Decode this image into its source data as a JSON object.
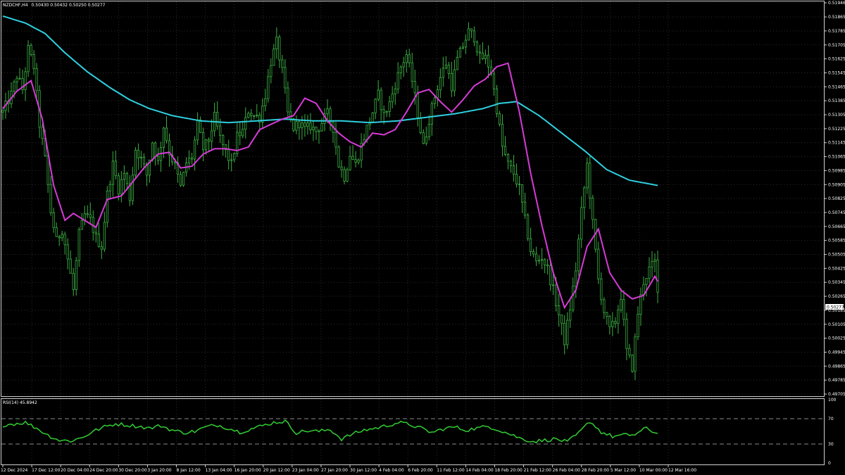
{
  "header": {
    "symbol": "NZDCHF,H4",
    "ohlc": "0.50430 0.50432 0.50250 0.50277"
  },
  "colors": {
    "background": "#000000",
    "grid": "#2a2a2a",
    "candle": "#3cb043",
    "ma_fast": "#d63bd6",
    "ma_slow": "#2fd0e0",
    "rsi_line": "#32cd32",
    "rsi_level": "#8a8a8a",
    "axis_text": "#ffffff",
    "frame": "#d0d0d0"
  },
  "chart_data": [
    {
      "type": "candlestick",
      "title": "NZDCHF,H4",
      "ohlc_label": "0.50430 0.50432 0.50250 0.50277",
      "ylim": [
        0.49705,
        0.51946
      ],
      "yticks": [
        "0.51946",
        "0.51865",
        "0.51785",
        "0.51705",
        "0.51625",
        "0.51545",
        "0.51465",
        "0.51385",
        "0.51305",
        "0.51225",
        "0.51145",
        "0.51065",
        "0.50985",
        "0.50905",
        "0.50825",
        "0.50745",
        "0.50665",
        "0.50585",
        "0.50505",
        "0.50425",
        "0.50345",
        "0.50265",
        "0.50185",
        "0.50105",
        "0.50025",
        "0.49945",
        "0.49865",
        "0.49785",
        "0.49705"
      ],
      "current_price": "0.50277",
      "close_anchors": [
        [
          0,
          0.5132
        ],
        [
          3,
          0.5142
        ],
        [
          5,
          0.5153
        ],
        [
          7,
          0.5145
        ],
        [
          9,
          0.5168
        ],
        [
          11,
          0.5158
        ],
        [
          13,
          0.5125
        ],
        [
          15,
          0.5105
        ],
        [
          17,
          0.5075
        ],
        [
          19,
          0.5058
        ],
        [
          21,
          0.5065
        ],
        [
          23,
          0.5048
        ],
        [
          25,
          0.503
        ],
        [
          27,
          0.5062
        ],
        [
          29,
          0.5073
        ],
        [
          31,
          0.507
        ],
        [
          33,
          0.506
        ],
        [
          35,
          0.5055
        ],
        [
          37,
          0.5085
        ],
        [
          39,
          0.5102
        ],
        [
          41,
          0.5088
        ],
        [
          43,
          0.5097
        ],
        [
          45,
          0.5083
        ],
        [
          47,
          0.5111
        ],
        [
          49,
          0.5105
        ],
        [
          51,
          0.5096
        ],
        [
          53,
          0.5115
        ],
        [
          55,
          0.5103
        ],
        [
          57,
          0.5124
        ],
        [
          59,
          0.5109
        ],
        [
          61,
          0.5101
        ],
        [
          63,
          0.5089
        ],
        [
          65,
          0.5103
        ],
        [
          67,
          0.5106
        ],
        [
          69,
          0.5125
        ],
        [
          71,
          0.5111
        ],
        [
          73,
          0.5116
        ],
        [
          75,
          0.5129
        ],
        [
          77,
          0.5117
        ],
        [
          79,
          0.5109
        ],
        [
          81,
          0.5102
        ],
        [
          83,
          0.5118
        ],
        [
          85,
          0.5121
        ],
        [
          87,
          0.5133
        ],
        [
          89,
          0.513
        ],
        [
          91,
          0.5129
        ],
        [
          93,
          0.5142
        ],
        [
          95,
          0.5161
        ],
        [
          97,
          0.5172
        ],
        [
          99,
          0.5155
        ],
        [
          101,
          0.5131
        ],
        [
          103,
          0.5123
        ],
        [
          105,
          0.5126
        ],
        [
          107,
          0.5122
        ],
        [
          109,
          0.5124
        ],
        [
          111,
          0.5121
        ],
        [
          113,
          0.5126
        ],
        [
          115,
          0.5131
        ],
        [
          117,
          0.5123
        ],
        [
          119,
          0.5102
        ],
        [
          121,
          0.5095
        ],
        [
          123,
          0.5108
        ],
        [
          125,
          0.5102
        ],
        [
          127,
          0.5113
        ],
        [
          129,
          0.5123
        ],
        [
          131,
          0.5132
        ],
        [
          133,
          0.5142
        ],
        [
          135,
          0.513
        ],
        [
          137,
          0.5137
        ],
        [
          139,
          0.5148
        ],
        [
          141,
          0.5158
        ],
        [
          143,
          0.5165
        ],
        [
          145,
          0.515
        ],
        [
          147,
          0.5131
        ],
        [
          149,
          0.5112
        ],
        [
          151,
          0.5128
        ],
        [
          153,
          0.5141
        ],
        [
          155,
          0.5152
        ],
        [
          157,
          0.516
        ],
        [
          159,
          0.5147
        ],
        [
          161,
          0.5162
        ],
        [
          163,
          0.517
        ],
        [
          165,
          0.5178
        ],
        [
          167,
          0.5175
        ],
        [
          169,
          0.5163
        ],
        [
          171,
          0.5163
        ],
        [
          173,
          0.5155
        ],
        [
          175,
          0.5134
        ],
        [
          177,
          0.5112
        ],
        [
          179,
          0.5102
        ],
        [
          181,
          0.5097
        ],
        [
          183,
          0.5088
        ],
        [
          185,
          0.507
        ],
        [
          187,
          0.5053
        ],
        [
          189,
          0.5046
        ],
        [
          191,
          0.5049
        ],
        [
          193,
          0.5042
        ],
        [
          195,
          0.503
        ],
        [
          197,
          0.5016
        ],
        [
          199,
          0.5001
        ],
        [
          201,
          0.502
        ],
        [
          203,
          0.5042
        ],
        [
          205,
          0.5075
        ],
        [
          207,
          0.5102
        ],
        [
          209,
          0.5068
        ],
        [
          211,
          0.5036
        ],
        [
          213,
          0.5018
        ],
        [
          215,
          0.5007
        ],
        [
          217,
          0.5012
        ],
        [
          219,
          0.5027
        ],
        [
          221,
          0.4995
        ],
        [
          223,
          0.4986
        ],
        [
          225,
          0.5017
        ],
        [
          227,
          0.5035
        ],
        [
          229,
          0.5042
        ],
        [
          231,
          0.5046
        ],
        [
          232,
          0.50277
        ]
      ],
      "ma_fast_anchors": [
        [
          0,
          0.5134
        ],
        [
          5,
          0.5144
        ],
        [
          10,
          0.515
        ],
        [
          14,
          0.5128
        ],
        [
          18,
          0.509
        ],
        [
          22,
          0.507
        ],
        [
          25,
          0.5074
        ],
        [
          29,
          0.507
        ],
        [
          33,
          0.5066
        ],
        [
          37,
          0.5082
        ],
        [
          42,
          0.5084
        ],
        [
          46,
          0.5092
        ],
        [
          50,
          0.51
        ],
        [
          55,
          0.5108
        ],
        [
          59,
          0.5109
        ],
        [
          63,
          0.51
        ],
        [
          67,
          0.5101
        ],
        [
          71,
          0.5108
        ],
        [
          75,
          0.5111
        ],
        [
          79,
          0.5111
        ],
        [
          83,
          0.511
        ],
        [
          87,
          0.5112
        ],
        [
          91,
          0.5122
        ],
        [
          95,
          0.5125
        ],
        [
          99,
          0.5128
        ],
        [
          103,
          0.513
        ],
        [
          107,
          0.514
        ],
        [
          111,
          0.5137
        ],
        [
          115,
          0.5127
        ],
        [
          119,
          0.512
        ],
        [
          123,
          0.5115
        ],
        [
          127,
          0.5112
        ],
        [
          131,
          0.512
        ],
        [
          135,
          0.5119
        ],
        [
          139,
          0.5122
        ],
        [
          143,
          0.5132
        ],
        [
          147,
          0.5143
        ],
        [
          151,
          0.5145
        ],
        [
          155,
          0.5138
        ],
        [
          159,
          0.5132
        ],
        [
          163,
          0.5139
        ],
        [
          167,
          0.5147
        ],
        [
          171,
          0.5151
        ],
        [
          175,
          0.5158
        ],
        [
          179,
          0.516
        ],
        [
          183,
          0.5132
        ],
        [
          187,
          0.5097
        ],
        [
          191,
          0.5067
        ],
        [
          195,
          0.504
        ],
        [
          199,
          0.502
        ],
        [
          203,
          0.503
        ],
        [
          207,
          0.5055
        ],
        [
          211,
          0.5065
        ],
        [
          215,
          0.504
        ],
        [
          219,
          0.503
        ],
        [
          223,
          0.5025
        ],
        [
          227,
          0.5027
        ],
        [
          231,
          0.5038
        ],
        [
          232,
          0.5035
        ]
      ],
      "ma_slow_anchors": [
        [
          0,
          0.5187
        ],
        [
          8,
          0.5183
        ],
        [
          15,
          0.5177
        ],
        [
          22,
          0.5166
        ],
        [
          30,
          0.5155
        ],
        [
          38,
          0.5146
        ],
        [
          45,
          0.5139
        ],
        [
          52,
          0.5134
        ],
        [
          60,
          0.513
        ],
        [
          70,
          0.5127
        ],
        [
          80,
          0.5126
        ],
        [
          90,
          0.5127
        ],
        [
          100,
          0.5128
        ],
        [
          110,
          0.5127
        ],
        [
          120,
          0.5127
        ],
        [
          130,
          0.5126
        ],
        [
          140,
          0.5127
        ],
        [
          150,
          0.5129
        ],
        [
          160,
          0.5131
        ],
        [
          170,
          0.5134
        ],
        [
          176,
          0.5137
        ],
        [
          182,
          0.5138
        ],
        [
          190,
          0.513
        ],
        [
          198,
          0.512
        ],
        [
          206,
          0.511
        ],
        [
          214,
          0.5099
        ],
        [
          222,
          0.5093
        ],
        [
          232,
          0.509
        ]
      ],
      "bars": 233
    },
    {
      "type": "line",
      "title": "RSI(14) 45.8942",
      "ylim": [
        0,
        100
      ],
      "yticks": [
        "100",
        "70",
        "30",
        "0"
      ],
      "levels": [
        70,
        30
      ],
      "rsi_anchors": [
        [
          0,
          60
        ],
        [
          4,
          62
        ],
        [
          8,
          64
        ],
        [
          12,
          55
        ],
        [
          16,
          44
        ],
        [
          20,
          36
        ],
        [
          24,
          35
        ],
        [
          28,
          40
        ],
        [
          32,
          50
        ],
        [
          36,
          57
        ],
        [
          40,
          62
        ],
        [
          44,
          60
        ],
        [
          48,
          58
        ],
        [
          52,
          55
        ],
        [
          56,
          59
        ],
        [
          60,
          52
        ],
        [
          64,
          48
        ],
        [
          68,
          50
        ],
        [
          72,
          57
        ],
        [
          76,
          60
        ],
        [
          80,
          55
        ],
        [
          84,
          49
        ],
        [
          88,
          54
        ],
        [
          92,
          59
        ],
        [
          96,
          64
        ],
        [
          100,
          66
        ],
        [
          104,
          48
        ],
        [
          108,
          51
        ],
        [
          112,
          50
        ],
        [
          116,
          53
        ],
        [
          120,
          38
        ],
        [
          124,
          46
        ],
        [
          128,
          52
        ],
        [
          132,
          55
        ],
        [
          136,
          59
        ],
        [
          140,
          64
        ],
        [
          144,
          61
        ],
        [
          148,
          55
        ],
        [
          152,
          48
        ],
        [
          156,
          54
        ],
        [
          160,
          57
        ],
        [
          164,
          52
        ],
        [
          168,
          55
        ],
        [
          172,
          58
        ],
        [
          176,
          52
        ],
        [
          180,
          45
        ],
        [
          184,
          38
        ],
        [
          188,
          34
        ],
        [
          192,
          36
        ],
        [
          196,
          38
        ],
        [
          200,
          33
        ],
        [
          204,
          47
        ],
        [
          208,
          66
        ],
        [
          212,
          49
        ],
        [
          216,
          42
        ],
        [
          220,
          44
        ],
        [
          224,
          45
        ],
        [
          228,
          55
        ],
        [
          232,
          46
        ]
      ]
    }
  ],
  "x_axis_labels": [
    "12 Dec 2024",
    "17 Dec 12:00",
    "20 Dec 04:00",
    "24 Dec 20:00",
    "30 Dec 20:00",
    "3 Jan 20:00",
    "8 Jan 12:00",
    "13 Jan 04:00",
    "16 Jan 20:00",
    "20 Jan 12:00",
    "23 Jan 04:00",
    "27 Jan 20:00",
    "30 Jan 12:00",
    "4 Feb 04:00",
    "6 Feb 20:00",
    "11 Feb 12:00",
    "14 Feb 04:00",
    "18 Feb 20:00",
    "21 Feb 12:00",
    "26 Feb 04:00",
    "28 Feb 20:00",
    "5 Mar 12:00",
    "10 Mar 00:00",
    "12 Mar 16:00"
  ]
}
